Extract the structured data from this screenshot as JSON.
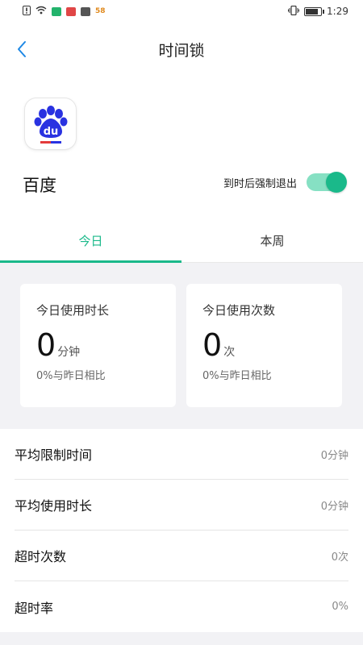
{
  "status_bar": {
    "time": "1:29",
    "left_icons": [
      "sim-alert-icon",
      "wifi-icon",
      "app-notification-icon",
      "app-notification-icon",
      "app-notification-icon",
      "app-58-icon"
    ],
    "badge_58": "58"
  },
  "nav": {
    "title": "时间锁"
  },
  "app": {
    "name": "百度",
    "icon": "baidu-paw-icon",
    "icon_text": "du",
    "brand_color": "#2932e1"
  },
  "force_exit": {
    "label": "到时后强制退出",
    "enabled": true
  },
  "tabs": [
    {
      "label": "今日",
      "active": true
    },
    {
      "label": "本周",
      "active": false
    }
  ],
  "cards": [
    {
      "label": "今日使用时长",
      "value": "0",
      "unit": "分钟",
      "compare": "0%与昨日相比"
    },
    {
      "label": "今日使用次数",
      "value": "0",
      "unit": "次",
      "compare": "0%与昨日相比"
    }
  ],
  "stats": [
    {
      "label": "平均限制时间",
      "value": "0分钟"
    },
    {
      "label": "平均使用时长",
      "value": "0分钟"
    },
    {
      "label": "超时次数",
      "value": "0次"
    },
    {
      "label": "超时率",
      "value": "0%"
    }
  ],
  "colors": {
    "accent": "#1ab98a",
    "toggle_track": "#86e0c3",
    "back_arrow": "#1e88e5",
    "background_gray": "#f2f2f5"
  }
}
